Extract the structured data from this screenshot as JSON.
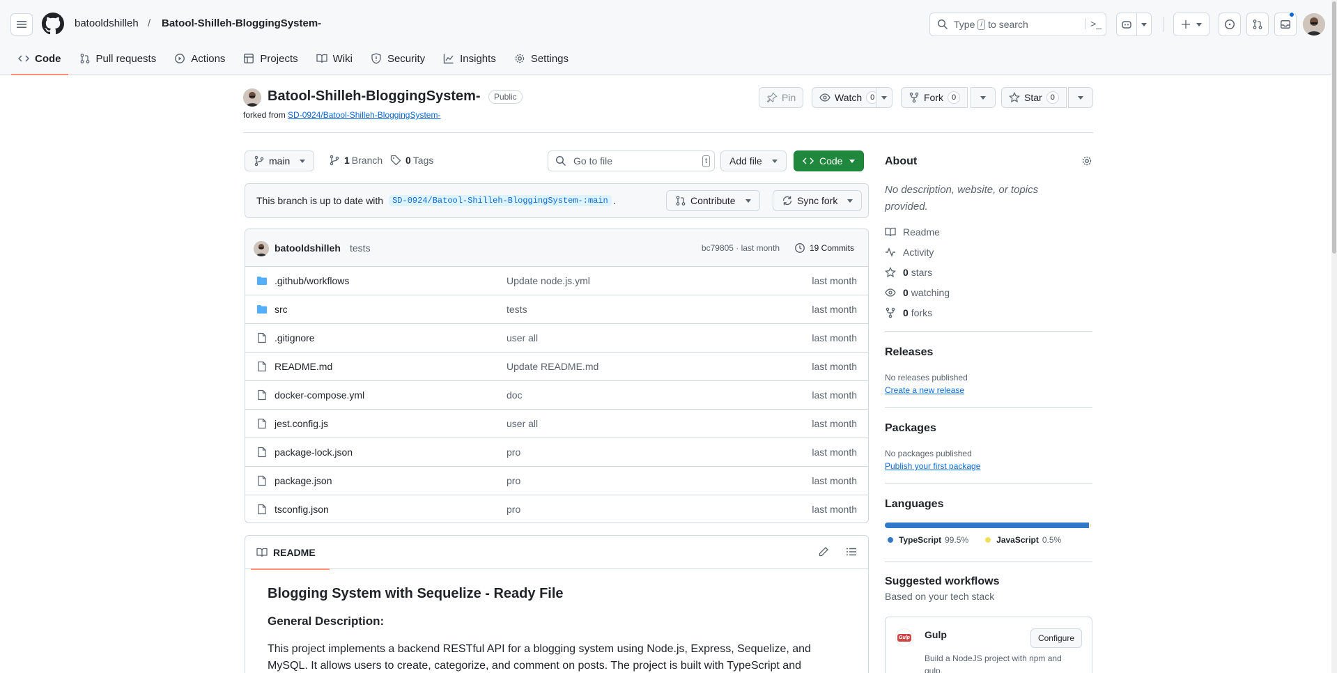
{
  "header": {
    "owner": "batooldshilleh",
    "separator": "/",
    "repo": "Batool-Shilleh-BloggingSystem-",
    "search_prefix": "Type",
    "search_key": "/",
    "search_suffix": "to search",
    "terminal_glyph": ">_"
  },
  "nav": {
    "tabs": [
      {
        "label": "Code",
        "icon": "code-icon"
      },
      {
        "label": "Pull requests",
        "icon": "pull-request-icon"
      },
      {
        "label": "Actions",
        "icon": "play-icon"
      },
      {
        "label": "Projects",
        "icon": "table-icon"
      },
      {
        "label": "Wiki",
        "icon": "book-icon"
      },
      {
        "label": "Security",
        "icon": "shield-icon"
      },
      {
        "label": "Insights",
        "icon": "graph-icon"
      },
      {
        "label": "Settings",
        "icon": "gear-icon"
      }
    ],
    "active": "Code"
  },
  "repo": {
    "name": "Batool-Shilleh-BloggingSystem-",
    "visibility": "Public",
    "forked_from_prefix": "forked from",
    "forked_from": "SD-0924/Batool-Shilleh-BloggingSystem-",
    "pin_label": "Pin",
    "watch_label": "Watch",
    "watch_count": "0",
    "fork_label": "Fork",
    "fork_count": "0",
    "star_label": "Star",
    "star_count": "0"
  },
  "toolbar": {
    "branch": "main",
    "branch_count": "1",
    "branch_label": "Branch",
    "tag_count": "0",
    "tag_label": "Tags",
    "goto_placeholder": "Go to file",
    "goto_key": "t",
    "add_file": "Add file",
    "code_button": "Code"
  },
  "sync": {
    "prefix": "This branch is up to date with",
    "upstream": "SD-0924/Batool-Shilleh-BloggingSystem-:main",
    "suffix": ".",
    "contribute": "Contribute",
    "sync_fork": "Sync fork"
  },
  "latest_commit": {
    "author": "batooldshilleh",
    "message": "tests",
    "sha_time": "bc79805 · last month",
    "commits": "19 Commits"
  },
  "files": [
    {
      "name": ".github/workflows",
      "type": "dir",
      "commit": "Update node.js.yml",
      "time": "last month"
    },
    {
      "name": "src",
      "type": "dir",
      "commit": "tests",
      "time": "last month"
    },
    {
      "name": ".gitignore",
      "type": "file",
      "commit": "user all",
      "time": "last month"
    },
    {
      "name": "README.md",
      "type": "file",
      "commit": "Update README.md",
      "time": "last month"
    },
    {
      "name": "docker-compose.yml",
      "type": "file",
      "commit": "doc",
      "time": "last month"
    },
    {
      "name": "jest.config.js",
      "type": "file",
      "commit": "user all",
      "time": "last month"
    },
    {
      "name": "package-lock.json",
      "type": "file",
      "commit": "pro",
      "time": "last month"
    },
    {
      "name": "package.json",
      "type": "file",
      "commit": "pro",
      "time": "last month"
    },
    {
      "name": "tsconfig.json",
      "type": "file",
      "commit": "pro",
      "time": "last month"
    }
  ],
  "readme": {
    "tab": "README",
    "title": "Blogging System with Sequelize - Ready File",
    "section": "General Description:",
    "body": "This project implements a backend RESTful API for a blogging system using Node.js, Express, Sequelize, and MySQL. It allows users to create, categorize, and comment on posts. The project is built with TypeScript and"
  },
  "about": {
    "title": "About",
    "description": "No description, website, or topics provided.",
    "readme": "Readme",
    "activity": "Activity",
    "stars_count": "0",
    "stars_label": "stars",
    "watching_count": "0",
    "watching_label": "watching",
    "forks_count": "0",
    "forks_label": "forks"
  },
  "releases": {
    "title": "Releases",
    "none": "No releases published",
    "create": "Create a new release"
  },
  "packages": {
    "title": "Packages",
    "none": "No packages published",
    "publish": "Publish your first package"
  },
  "languages": {
    "title": "Languages",
    "items": [
      {
        "name": "TypeScript",
        "percent": "99.5%",
        "value": 99.5,
        "color": "#3178c6"
      },
      {
        "name": "JavaScript",
        "percent": "0.5%",
        "value": 0.5,
        "color": "#f1e05a"
      }
    ]
  },
  "workflows": {
    "title": "Suggested workflows",
    "subtitle": "Based on your tech stack",
    "card_name": "Gulp",
    "card_logo_text": "Gulp",
    "card_button": "Configure",
    "card_desc": "Build a NodeJS project with npm and gulp."
  },
  "colors": {
    "accent": "#0969da",
    "code_button": "#1f883d",
    "active_tab_underline": "#fd8c73",
    "folder": "#54aeff"
  }
}
